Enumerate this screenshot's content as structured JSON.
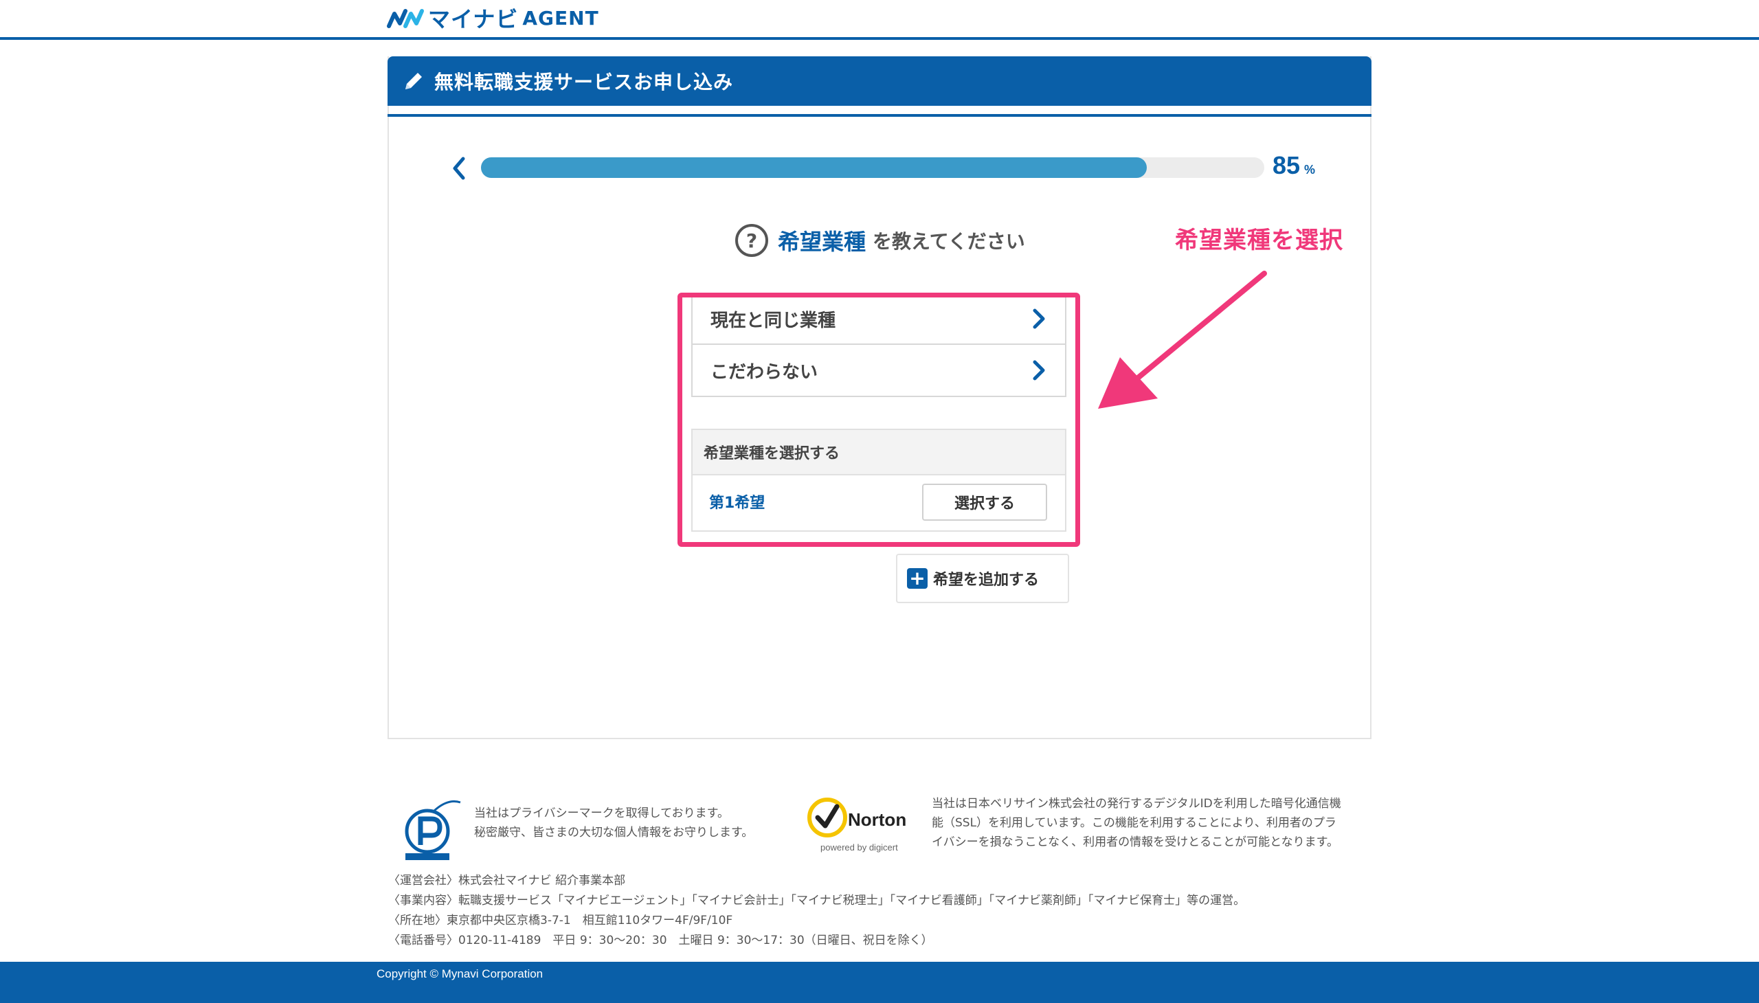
{
  "header": {
    "logo_text": "マイナビ",
    "logo_sub": "AGENT"
  },
  "card": {
    "title": "無料転職支援サービスお申し込み"
  },
  "progress": {
    "value": 85,
    "value_text": "85",
    "unit": "%"
  },
  "question": {
    "icon_char": "?",
    "keyword": "希望業種",
    "rest": "を教えてください"
  },
  "options": [
    {
      "label": "現在と同じ業種"
    },
    {
      "label": "こだわらない"
    }
  ],
  "select": {
    "heading": "希望業種を選択する",
    "choice_label": "第1希望",
    "button_label": "選択する"
  },
  "add": {
    "label": "希望を追加する",
    "icon_char": "+"
  },
  "annotation": {
    "text": "希望業種を選択",
    "color": "#f0387a"
  },
  "footer": {
    "privacy_lines": [
      "当社はプライバシーマークを取得しております。",
      "秘密厳守、皆さまの大切な個人情報をお守りします。"
    ],
    "norton_logo_text": "Norton",
    "norton_powered": "powered by digicert",
    "ssl_lines": [
      "当社は日本ベリサイン株式会社の発行するデジタルIDを利用した暗号化通信機",
      "能（SSL）を利用しています。この機能を利用することにより、利用者のプラ",
      "イバシーを損なうことなく、利用者の情報を受けとることが可能となります。"
    ],
    "company_lines": [
      "〈運営会社〉株式会社マイナビ 紹介事業本部",
      "〈事業内容〉転職支援サービス「マイナビエージェント」「マイナビ会計士」「マイナビ税理士」「マイナビ看護師」「マイナビ薬剤師」「マイナビ保育士」等の運営。",
      "〈所在地〉東京都中央区京橋3-7-1　相互館110タワー4F/9F/10F",
      "〈電話番号〉0120-11-4189　平日 9：30〜20：30　土曜日 9：30〜17：30（日曜日、祝日を除く）"
    ],
    "copyright": "Copyright © Mynavi Corporation"
  },
  "colors": {
    "brand_blue": "#0a5fa8",
    "progress_fill": "#3a9ac9",
    "annotation_pink": "#f0387a"
  }
}
